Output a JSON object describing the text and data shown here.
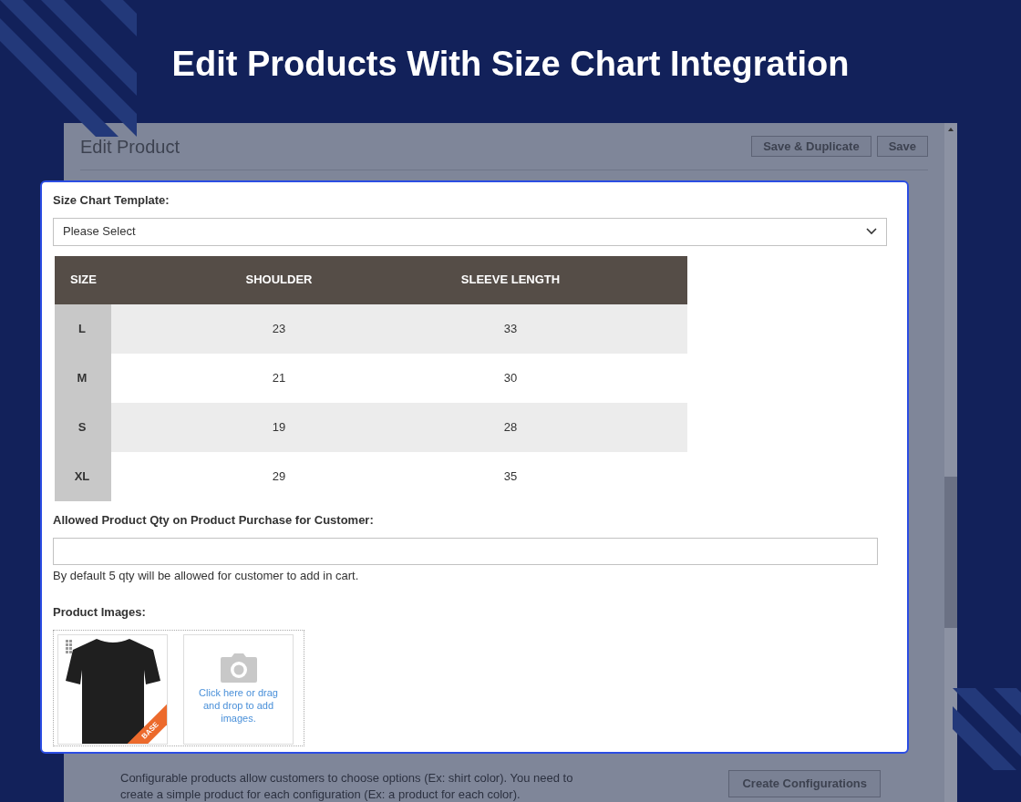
{
  "banner": {
    "title": "Edit Products With Size Chart Integration"
  },
  "panel": {
    "title": "Edit Product",
    "buttons": [
      "Save & Duplicate",
      "Save"
    ],
    "configurable_text": "Configurable products allow customers to choose options (Ex: shirt color). You need to create a simple product for each configuration (Ex: a product for each color).",
    "configurable_button": "Create Configurations"
  },
  "modal": {
    "size_chart": {
      "label": "Size Chart Template:",
      "select_value": "Please Select"
    },
    "table": {
      "columns": [
        "SIZE",
        "SHOULDER",
        "SLEEVE LENGTH"
      ],
      "rows": [
        [
          "L",
          "23",
          "33"
        ],
        [
          "M",
          "21",
          "30"
        ],
        [
          "S",
          "19",
          "28"
        ],
        [
          "XL",
          "29",
          "35"
        ]
      ]
    },
    "qty": {
      "label": "Allowed Product Qty on Product Purchase for Customer:",
      "help": "By default 5 qty will be allowed for customer to add in cart."
    },
    "images": {
      "label": "Product Images:",
      "base_badge": "BASE",
      "upload_text": "Click here or drag and drop to add images."
    }
  }
}
